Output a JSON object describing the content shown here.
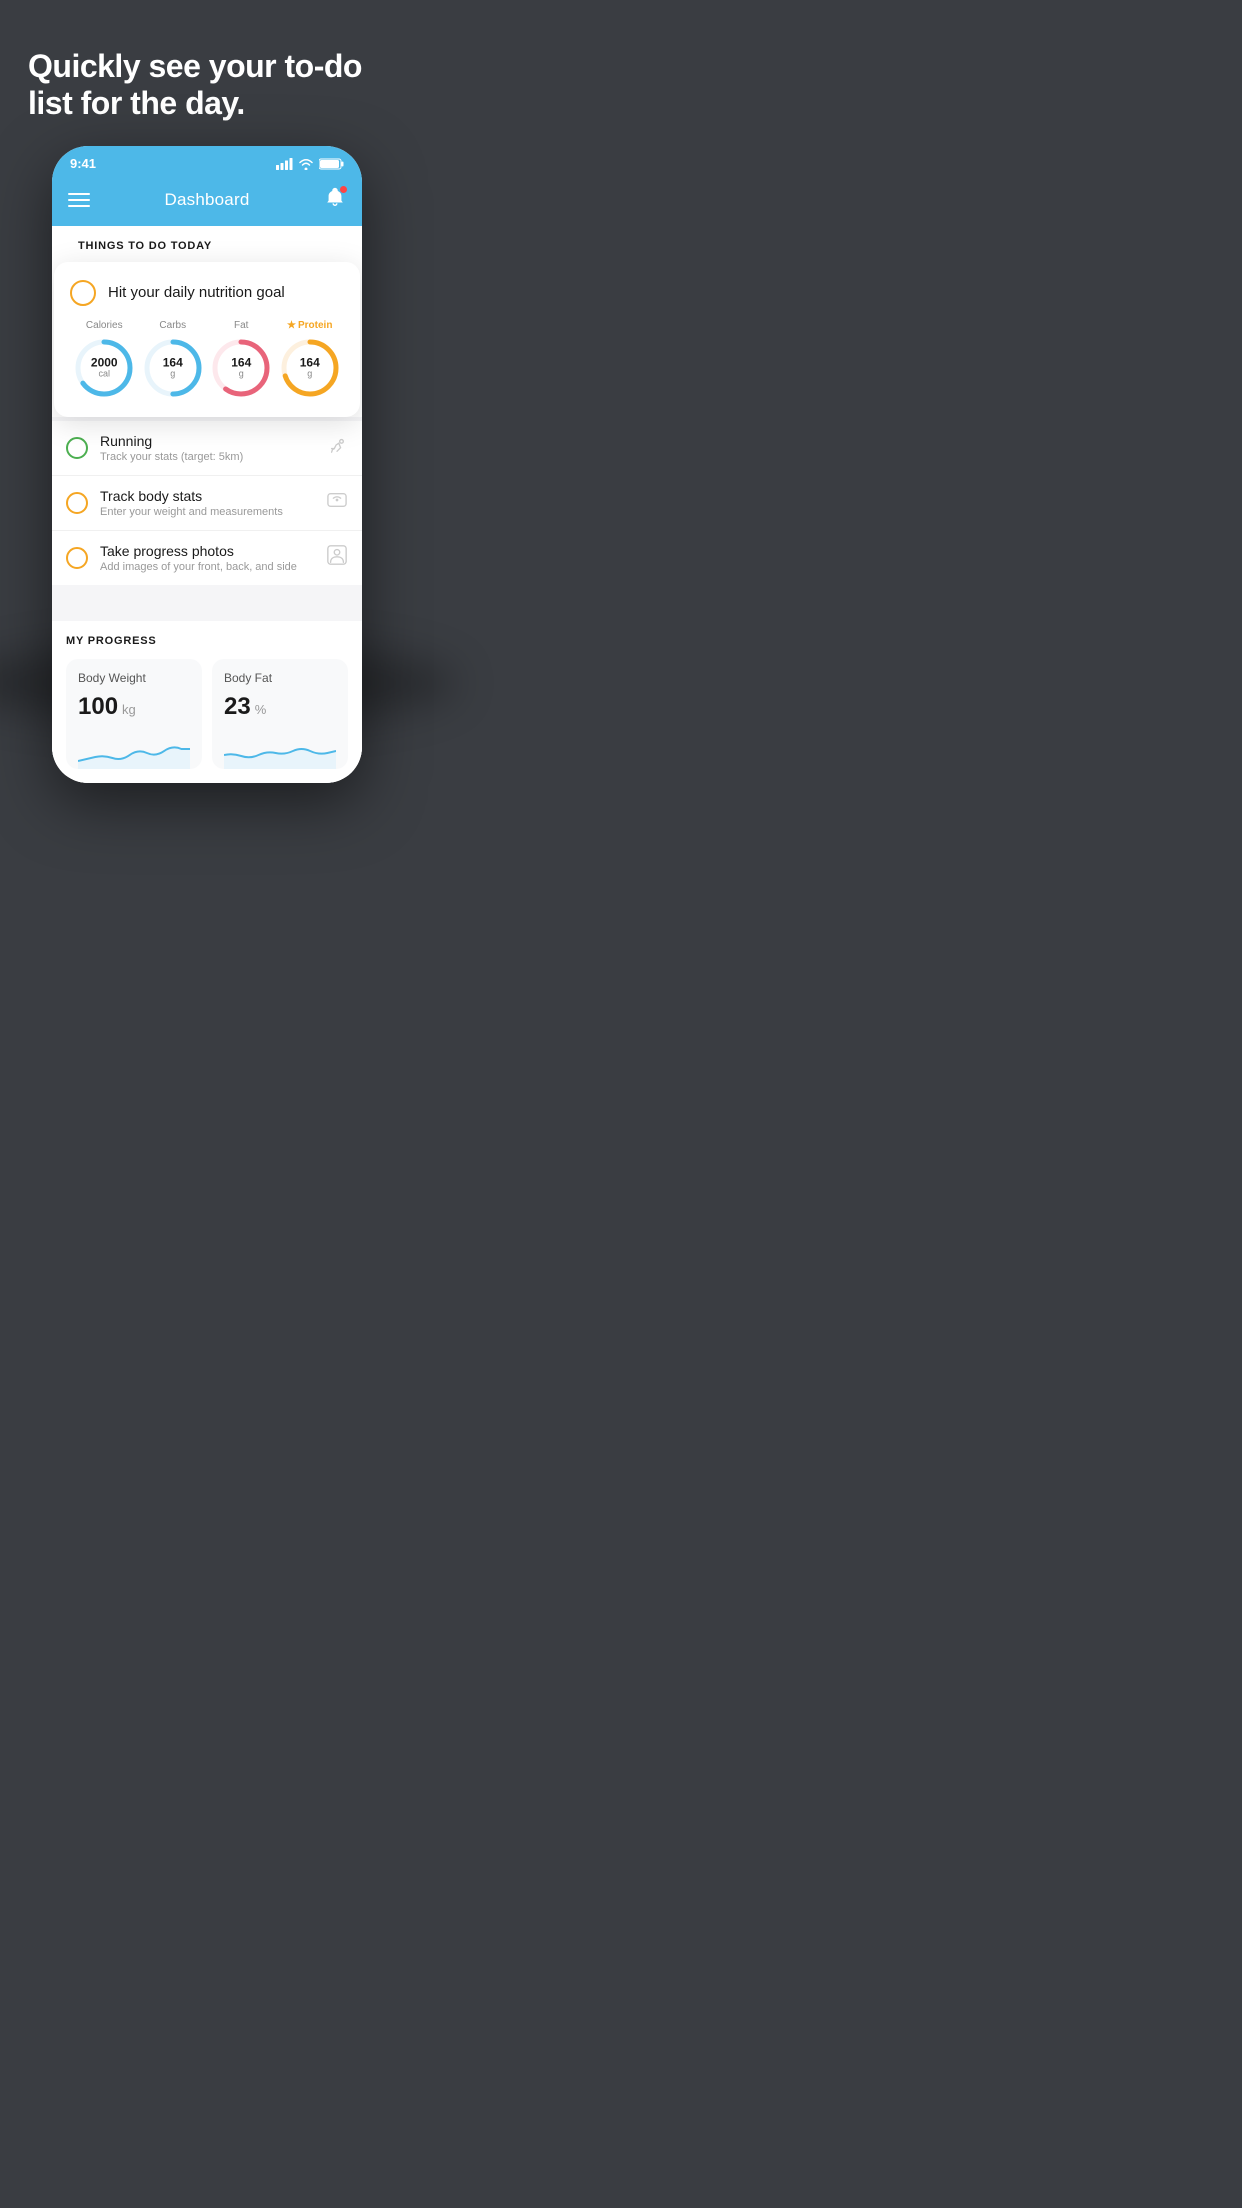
{
  "hero": {
    "title": "Quickly see your to-do list for the day."
  },
  "statusBar": {
    "time": "9:41",
    "icons": "▐▐▐ ◈ ▓▓"
  },
  "header": {
    "title": "Dashboard"
  },
  "thingsToDo": {
    "sectionLabel": "THINGS TO DO TODAY",
    "nutritionCard": {
      "title": "Hit your daily nutrition goal",
      "macros": [
        {
          "label": "Calories",
          "value": "2000",
          "unit": "cal",
          "color": "#4db8e8",
          "percent": 65,
          "star": false
        },
        {
          "label": "Carbs",
          "value": "164",
          "unit": "g",
          "color": "#4db8e8",
          "percent": 50,
          "star": false
        },
        {
          "label": "Fat",
          "value": "164",
          "unit": "g",
          "color": "#e8647a",
          "percent": 60,
          "star": false
        },
        {
          "label": "Protein",
          "value": "164",
          "unit": "g",
          "color": "#f5a623",
          "percent": 70,
          "star": true
        }
      ]
    },
    "items": [
      {
        "name": "Running",
        "desc": "Track your stats (target: 5km)",
        "circleColor": "green",
        "icon": "👟"
      },
      {
        "name": "Track body stats",
        "desc": "Enter your weight and measurements",
        "circleColor": "yellow",
        "icon": "⚖"
      },
      {
        "name": "Take progress photos",
        "desc": "Add images of your front, back, and side",
        "circleColor": "yellow",
        "icon": "👤"
      }
    ]
  },
  "progress": {
    "sectionLabel": "MY PROGRESS",
    "cards": [
      {
        "title": "Body Weight",
        "value": "100",
        "unit": "kg"
      },
      {
        "title": "Body Fat",
        "value": "23",
        "unit": "%"
      }
    ]
  }
}
